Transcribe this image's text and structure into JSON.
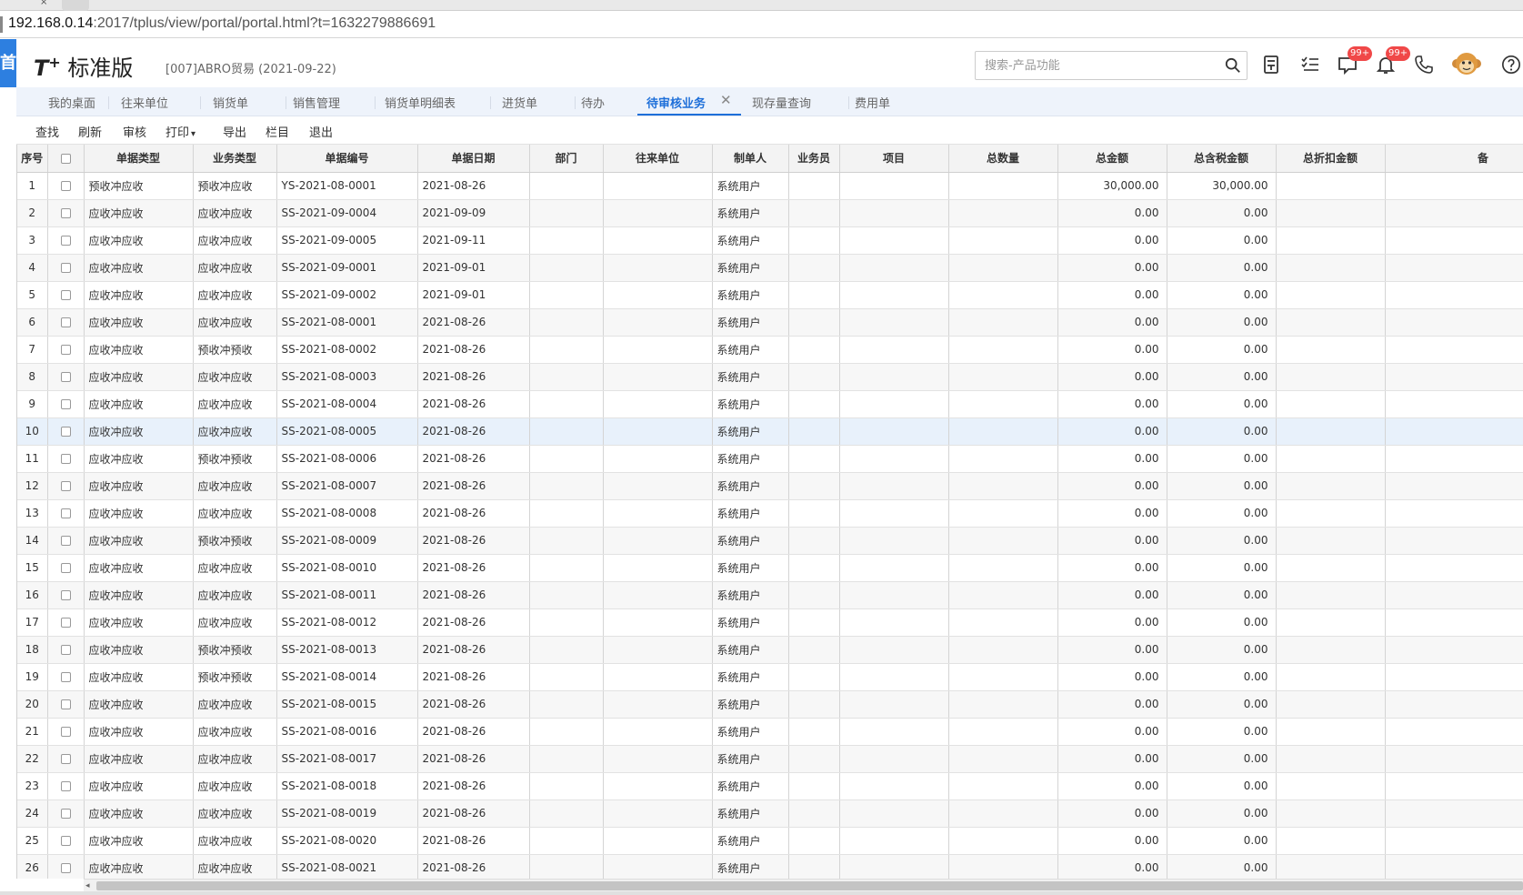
{
  "browser": {
    "url_host": "192.168.0.14",
    "url_rest": ":2017/tplus/view/portal/portal.html?t=1632279886691"
  },
  "header": {
    "logo_mark": "T",
    "logo_plus": "+",
    "logo_text": "标准版",
    "company": "[007]ABRO贸易   (2021-09-22)",
    "left_char": "首",
    "search_placeholder": "搜索-产品功能",
    "msg_badge": "99+",
    "bell_badge": "99+"
  },
  "tabs": [
    {
      "label": "我的桌面"
    },
    {
      "label": "往来单位"
    },
    {
      "label": "销货单"
    },
    {
      "label": "销售管理"
    },
    {
      "label": "销货单明细表"
    },
    {
      "label": "进货单"
    },
    {
      "label": "待办"
    },
    {
      "label": "待审核业务"
    },
    {
      "label": "现存量查询"
    },
    {
      "label": "费用单"
    }
  ],
  "active_tab_close": "✕",
  "toolbar": {
    "find": "查找",
    "refresh": "刷新",
    "audit": "审核",
    "print": "打印",
    "export": "导出",
    "columns": "栏目",
    "exit": "退出"
  },
  "grid": {
    "columns": [
      "序号",
      "",
      "单据类型",
      "业务类型",
      "单据编号",
      "单据日期",
      "部门",
      "往来单位",
      "制单人",
      "业务员",
      "项目",
      "总数量",
      "总金额",
      "总含税金额",
      "总折扣金额",
      "备"
    ],
    "rows": [
      [
        "1",
        "预收冲应收",
        "预收冲应收",
        "YS-2021-08-0001",
        "2021-08-26",
        "系统用户",
        "30,000.00",
        "30,000.00"
      ],
      [
        "2",
        "应收冲应收",
        "应收冲应收",
        "SS-2021-09-0004",
        "2021-09-09",
        "系统用户",
        "0.00",
        "0.00"
      ],
      [
        "3",
        "应收冲应收",
        "应收冲应收",
        "SS-2021-09-0005",
        "2021-09-11",
        "系统用户",
        "0.00",
        "0.00"
      ],
      [
        "4",
        "应收冲应收",
        "应收冲应收",
        "SS-2021-09-0001",
        "2021-09-01",
        "系统用户",
        "0.00",
        "0.00"
      ],
      [
        "5",
        "应收冲应收",
        "应收冲应收",
        "SS-2021-09-0002",
        "2021-09-01",
        "系统用户",
        "0.00",
        "0.00"
      ],
      [
        "6",
        "应收冲应收",
        "应收冲应收",
        "SS-2021-08-0001",
        "2021-08-26",
        "系统用户",
        "0.00",
        "0.00"
      ],
      [
        "7",
        "应收冲应收",
        "预收冲预收",
        "SS-2021-08-0002",
        "2021-08-26",
        "系统用户",
        "0.00",
        "0.00"
      ],
      [
        "8",
        "应收冲应收",
        "应收冲应收",
        "SS-2021-08-0003",
        "2021-08-26",
        "系统用户",
        "0.00",
        "0.00"
      ],
      [
        "9",
        "应收冲应收",
        "应收冲应收",
        "SS-2021-08-0004",
        "2021-08-26",
        "系统用户",
        "0.00",
        "0.00"
      ],
      [
        "10",
        "应收冲应收",
        "应收冲应收",
        "SS-2021-08-0005",
        "2021-08-26",
        "系统用户",
        "0.00",
        "0.00"
      ],
      [
        "11",
        "应收冲应收",
        "预收冲预收",
        "SS-2021-08-0006",
        "2021-08-26",
        "系统用户",
        "0.00",
        "0.00"
      ],
      [
        "12",
        "应收冲应收",
        "应收冲应收",
        "SS-2021-08-0007",
        "2021-08-26",
        "系统用户",
        "0.00",
        "0.00"
      ],
      [
        "13",
        "应收冲应收",
        "应收冲应收",
        "SS-2021-08-0008",
        "2021-08-26",
        "系统用户",
        "0.00",
        "0.00"
      ],
      [
        "14",
        "应收冲应收",
        "预收冲预收",
        "SS-2021-08-0009",
        "2021-08-26",
        "系统用户",
        "0.00",
        "0.00"
      ],
      [
        "15",
        "应收冲应收",
        "应收冲应收",
        "SS-2021-08-0010",
        "2021-08-26",
        "系统用户",
        "0.00",
        "0.00"
      ],
      [
        "16",
        "应收冲应收",
        "应收冲应收",
        "SS-2021-08-0011",
        "2021-08-26",
        "系统用户",
        "0.00",
        "0.00"
      ],
      [
        "17",
        "应收冲应收",
        "应收冲应收",
        "SS-2021-08-0012",
        "2021-08-26",
        "系统用户",
        "0.00",
        "0.00"
      ],
      [
        "18",
        "应收冲应收",
        "预收冲预收",
        "SS-2021-08-0013",
        "2021-08-26",
        "系统用户",
        "0.00",
        "0.00"
      ],
      [
        "19",
        "应收冲应收",
        "预收冲预收",
        "SS-2021-08-0014",
        "2021-08-26",
        "系统用户",
        "0.00",
        "0.00"
      ],
      [
        "20",
        "应收冲应收",
        "应收冲应收",
        "SS-2021-08-0015",
        "2021-08-26",
        "系统用户",
        "0.00",
        "0.00"
      ],
      [
        "21",
        "应收冲应收",
        "应收冲应收",
        "SS-2021-08-0016",
        "2021-08-26",
        "系统用户",
        "0.00",
        "0.00"
      ],
      [
        "22",
        "应收冲应收",
        "应收冲应收",
        "SS-2021-08-0017",
        "2021-08-26",
        "系统用户",
        "0.00",
        "0.00"
      ],
      [
        "23",
        "应收冲应收",
        "应收冲应收",
        "SS-2021-08-0018",
        "2021-08-26",
        "系统用户",
        "0.00",
        "0.00"
      ],
      [
        "24",
        "应收冲应收",
        "应收冲应收",
        "SS-2021-08-0019",
        "2021-08-26",
        "系统用户",
        "0.00",
        "0.00"
      ],
      [
        "25",
        "应收冲应收",
        "应收冲应收",
        "SS-2021-08-0020",
        "2021-08-26",
        "系统用户",
        "0.00",
        "0.00"
      ],
      [
        "26",
        "应收冲应收",
        "应收冲应收",
        "SS-2021-08-0021",
        "2021-08-26",
        "系统用户",
        "0.00",
        "0.00"
      ]
    ],
    "selected_row": "10"
  },
  "colors": {
    "accent": "#1e6fd9",
    "sidebar_blue": "#2d7fe0",
    "badge_red": "#f04848",
    "selected_row": "#e8f1fb"
  }
}
